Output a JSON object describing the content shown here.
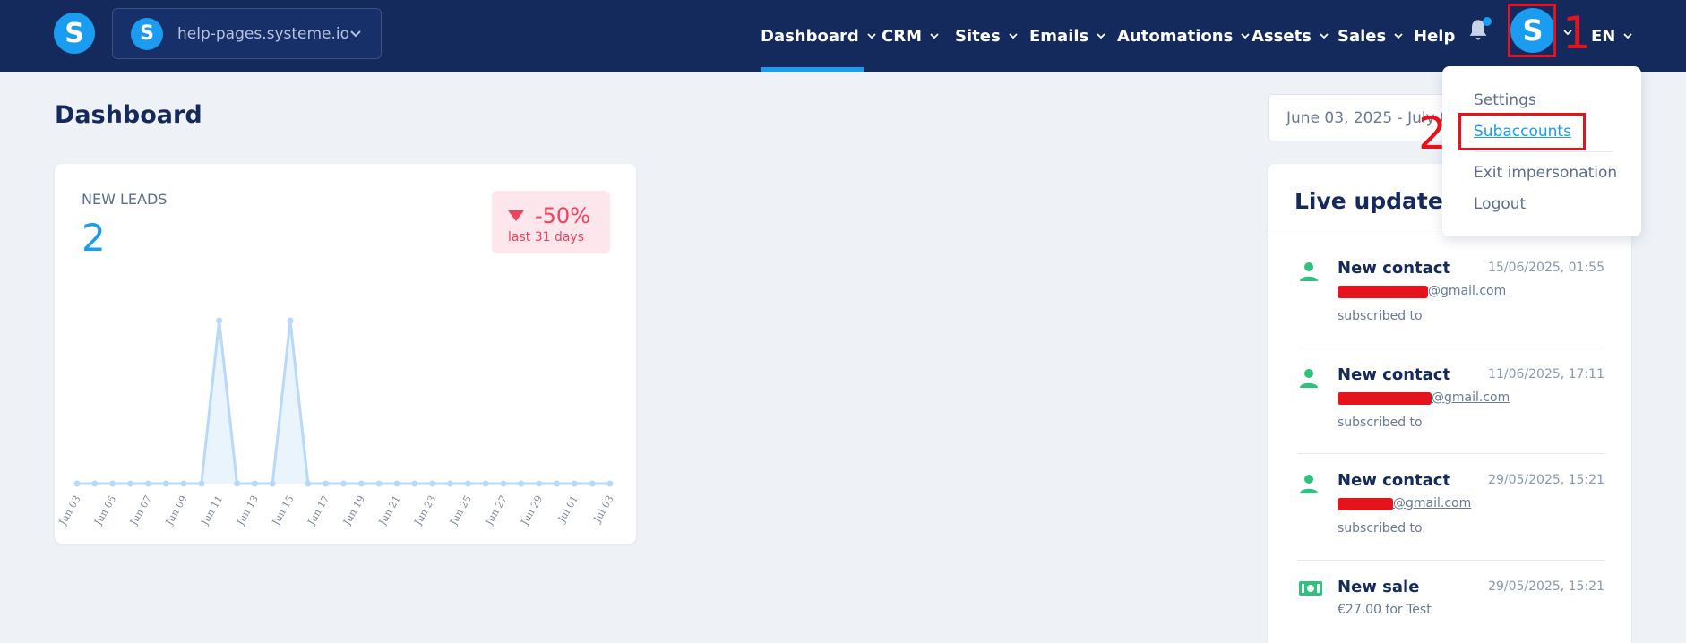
{
  "topbar": {
    "logo_letter": "S",
    "workspace": {
      "logo_letter": "S",
      "name": "help-pages.systeme.io"
    },
    "nav": [
      {
        "label": "Dashboard",
        "has_menu": true,
        "active": true
      },
      {
        "label": "CRM",
        "has_menu": true
      },
      {
        "label": "Sites",
        "has_menu": true
      },
      {
        "label": "Emails",
        "has_menu": true
      },
      {
        "label": "Automations",
        "has_menu": true
      },
      {
        "label": "Assets",
        "has_menu": true
      },
      {
        "label": "Sales",
        "has_menu": true
      },
      {
        "label": "Help",
        "has_menu": false
      }
    ],
    "avatar_letter": "S",
    "language": "EN",
    "notification_indicator": true
  },
  "annotations": {
    "step1": "1",
    "step2": "2",
    "color": "#e4141c"
  },
  "dashboard": {
    "title": "Dashboard",
    "date_range": "June 03, 2025 - July 0"
  },
  "leads": {
    "label": "NEW LEADS",
    "count": "2",
    "change": "-50%",
    "period": "last 31 days"
  },
  "chart_data": {
    "type": "area",
    "x": [
      "Jun 03",
      "Jun 04",
      "Jun 05",
      "Jun 06",
      "Jun 07",
      "Jun 08",
      "Jun 09",
      "Jun 10",
      "Jun 11",
      "Jun 12",
      "Jun 13",
      "Jun 14",
      "Jun 15",
      "Jun 16",
      "Jun 17",
      "Jun 18",
      "Jun 19",
      "Jun 20",
      "Jun 21",
      "Jun 22",
      "Jun 23",
      "Jun 24",
      "Jun 25",
      "Jun 26",
      "Jun 27",
      "Jun 28",
      "Jun 29",
      "Jun 30",
      "Jul 01",
      "Jul 02",
      "Jul 03"
    ],
    "tick_labels": [
      "Jun 03",
      "Jun 05",
      "Jun 07",
      "Jun 09",
      "Jun 11",
      "Jun 13",
      "Jun 15",
      "Jun 17",
      "Jun 19",
      "Jun 21",
      "Jun 23",
      "Jun 25",
      "Jun 27",
      "Jun 29",
      "Jul 01",
      "Jul 03"
    ],
    "series": [
      {
        "values": [
          0,
          0,
          0,
          0,
          0,
          0,
          0,
          0,
          1,
          0,
          0,
          0,
          1,
          0,
          0,
          0,
          0,
          0,
          0,
          0,
          0,
          0,
          0,
          0,
          0,
          0,
          0,
          0,
          0,
          0,
          0
        ]
      }
    ],
    "ylim": [
      0,
      1
    ],
    "grid": false,
    "color": "#b8d9f8",
    "fill": "#eaf4fd"
  },
  "live_updates": {
    "title": "Live updates",
    "items": [
      {
        "icon": "user",
        "title": "New contact",
        "time": "15/06/2025, 01:55",
        "email": "@gmail.com",
        "detail": "subscribed to"
      },
      {
        "icon": "user",
        "title": "New contact",
        "time": "11/06/2025, 17:11",
        "email": "@gmail.com",
        "detail": "subscribed to"
      },
      {
        "icon": "user",
        "title": "New contact",
        "time": "29/05/2025, 15:21",
        "email": "@gmail.com",
        "detail": "subscribed to"
      },
      {
        "icon": "money",
        "title": "New sale",
        "time": "29/05/2025, 15:21",
        "email": "",
        "detail": "€27.00 for Test"
      }
    ]
  },
  "dropdown": {
    "items": [
      {
        "label": "Settings",
        "active": false
      },
      {
        "label": "Subaccounts",
        "active": true
      },
      {
        "label": "Exit impersonation",
        "active": false
      },
      {
        "label": "Logout",
        "active": false
      }
    ]
  }
}
